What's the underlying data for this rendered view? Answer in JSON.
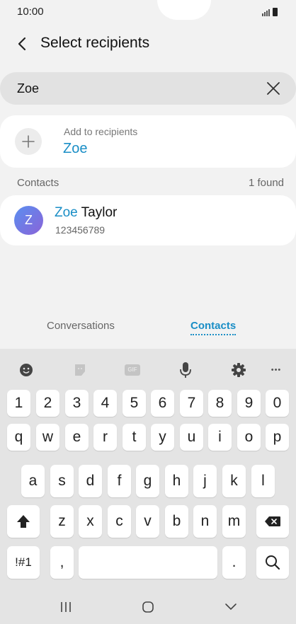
{
  "status_bar": {
    "time": "10:00"
  },
  "header": {
    "title": "Select recipients"
  },
  "search": {
    "value": "Zoe"
  },
  "add_card": {
    "subtitle": "Add to recipients",
    "name": "Zoe"
  },
  "contacts_section": {
    "title": "Contacts",
    "count": "1 found"
  },
  "contact": {
    "avatar_letter": "Z",
    "name_match": "Zoe",
    "name_rest": " Taylor",
    "number": "123456789"
  },
  "tabs": [
    {
      "label": "Conversations",
      "active": false
    },
    {
      "label": "Contacts",
      "active": true
    }
  ],
  "keyboard": {
    "toolbar": [
      "emoji-icon",
      "sticker-icon",
      "gif-icon",
      "microphone-icon",
      "settings-icon",
      "more-icon"
    ],
    "gif_label": "GIF",
    "more_label": "•••",
    "rows": [
      [
        "1",
        "2",
        "3",
        "4",
        "5",
        "6",
        "7",
        "8",
        "9",
        "0"
      ],
      [
        "q",
        "w",
        "e",
        "r",
        "t",
        "y",
        "u",
        "i",
        "o",
        "p"
      ],
      [
        "a",
        "s",
        "d",
        "f",
        "g",
        "h",
        "j",
        "k",
        "l"
      ],
      [
        "z",
        "x",
        "c",
        "v",
        "b",
        "n",
        "m"
      ]
    ],
    "symbols_label": "!#1",
    "comma_label": ",",
    "period_label": "."
  },
  "colors": {
    "accent": "#1a8ec6",
    "background": "#f2f2f2",
    "keyboard": "#e4e4e4"
  }
}
